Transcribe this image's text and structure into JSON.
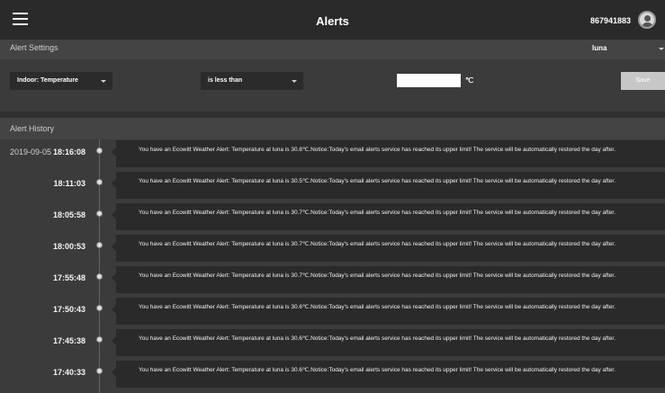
{
  "header": {
    "title": "Alerts",
    "user_id": "867941883"
  },
  "settings": {
    "section_label": "Alert Settings",
    "station": "luna",
    "parameter": "Indoor: Temperature",
    "condition": "is less than",
    "value": "",
    "unit": "℃",
    "save_label": "Save"
  },
  "history": {
    "section_label": "Alert History",
    "entries": [
      {
        "date": "2019-09-05",
        "time": "18:16:08",
        "message": "You have an Ecowitt Weather Alert: Temperature at luna is 30.8℃.Notice:Today's email alerts service has reached its upper limit! The service will be automatically restored the day after."
      },
      {
        "date": "",
        "time": "18:11:03",
        "message": "You have an Ecowitt Weather Alert: Temperature at luna is 30.5℃.Notice:Today's email alerts service has reached its upper limit! The service will be automatically restored the day after."
      },
      {
        "date": "",
        "time": "18:05:58",
        "message": "You have an Ecowitt Weather Alert: Temperature at luna is 30.7℃.Notice:Today's email alerts service has reached its upper limit! The service will be automatically restored the day after."
      },
      {
        "date": "",
        "time": "18:00:53",
        "message": "You have an Ecowitt Weather Alert: Temperature at luna is 30.7℃.Notice:Today's email alerts service has reached its upper limit! The service will be automatically restored the day after."
      },
      {
        "date": "",
        "time": "17:55:48",
        "message": "You have an Ecowitt Weather Alert: Temperature at luna is 30.7℃.Notice:Today's email alerts service has reached its upper limit! The service will be automatically restored the day after."
      },
      {
        "date": "",
        "time": "17:50:43",
        "message": "You have an Ecowitt Weather Alert: Temperature at luna is 30.6℃.Notice:Today's email alerts service has reached its upper limit! The service will be automatically restored the day after."
      },
      {
        "date": "",
        "time": "17:45:38",
        "message": "You have an Ecowitt Weather Alert: Temperature at luna is 30.6℃.Notice:Today's email alerts service has reached its upper limit! The service will be automatically restored the day after."
      },
      {
        "date": "",
        "time": "17:40:33",
        "message": "You have an Ecowitt Weather Alert: Temperature at luna is 30.6℃.Notice:Today's email alerts service has reached its upper limit! The service will be automatically restored the day after."
      }
    ]
  }
}
